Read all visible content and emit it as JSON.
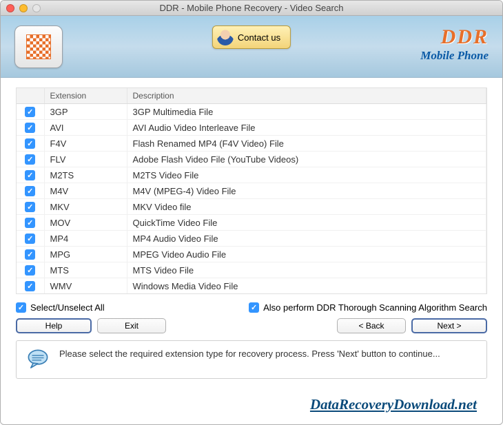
{
  "window": {
    "title": "DDR - Mobile Phone Recovery - Video Search"
  },
  "banner": {
    "contact_label": "Contact us",
    "brand_main": "DDR",
    "brand_sub": "Mobile Phone"
  },
  "table": {
    "headers": {
      "extension": "Extension",
      "description": "Description"
    },
    "rows": [
      {
        "ext": "3GP",
        "desc": "3GP Multimedia File"
      },
      {
        "ext": "AVI",
        "desc": "AVI Audio Video Interleave File"
      },
      {
        "ext": "F4V",
        "desc": "Flash Renamed MP4 (F4V Video) File"
      },
      {
        "ext": "FLV",
        "desc": "Adobe Flash Video File (YouTube Videos)"
      },
      {
        "ext": "M2TS",
        "desc": "M2TS Video File"
      },
      {
        "ext": "M4V",
        "desc": "M4V (MPEG-4) Video File"
      },
      {
        "ext": "MKV",
        "desc": "MKV Video file"
      },
      {
        "ext": "MOV",
        "desc": "QuickTime Video File"
      },
      {
        "ext": "MP4",
        "desc": "MP4 Audio Video File"
      },
      {
        "ext": "MPG",
        "desc": "MPEG Video Audio File"
      },
      {
        "ext": "MTS",
        "desc": "MTS Video File"
      },
      {
        "ext": "WMV",
        "desc": "Windows Media Video File"
      }
    ]
  },
  "options": {
    "select_all": "Select/Unselect All",
    "thorough": "Also perform DDR Thorough Scanning Algorithm Search"
  },
  "buttons": {
    "help": "Help",
    "exit": "Exit",
    "back": "< Back",
    "next": "Next >"
  },
  "hint": "Please select the required extension type for recovery process. Press 'Next' button to continue...",
  "watermark": "DataRecoveryDownload.net"
}
